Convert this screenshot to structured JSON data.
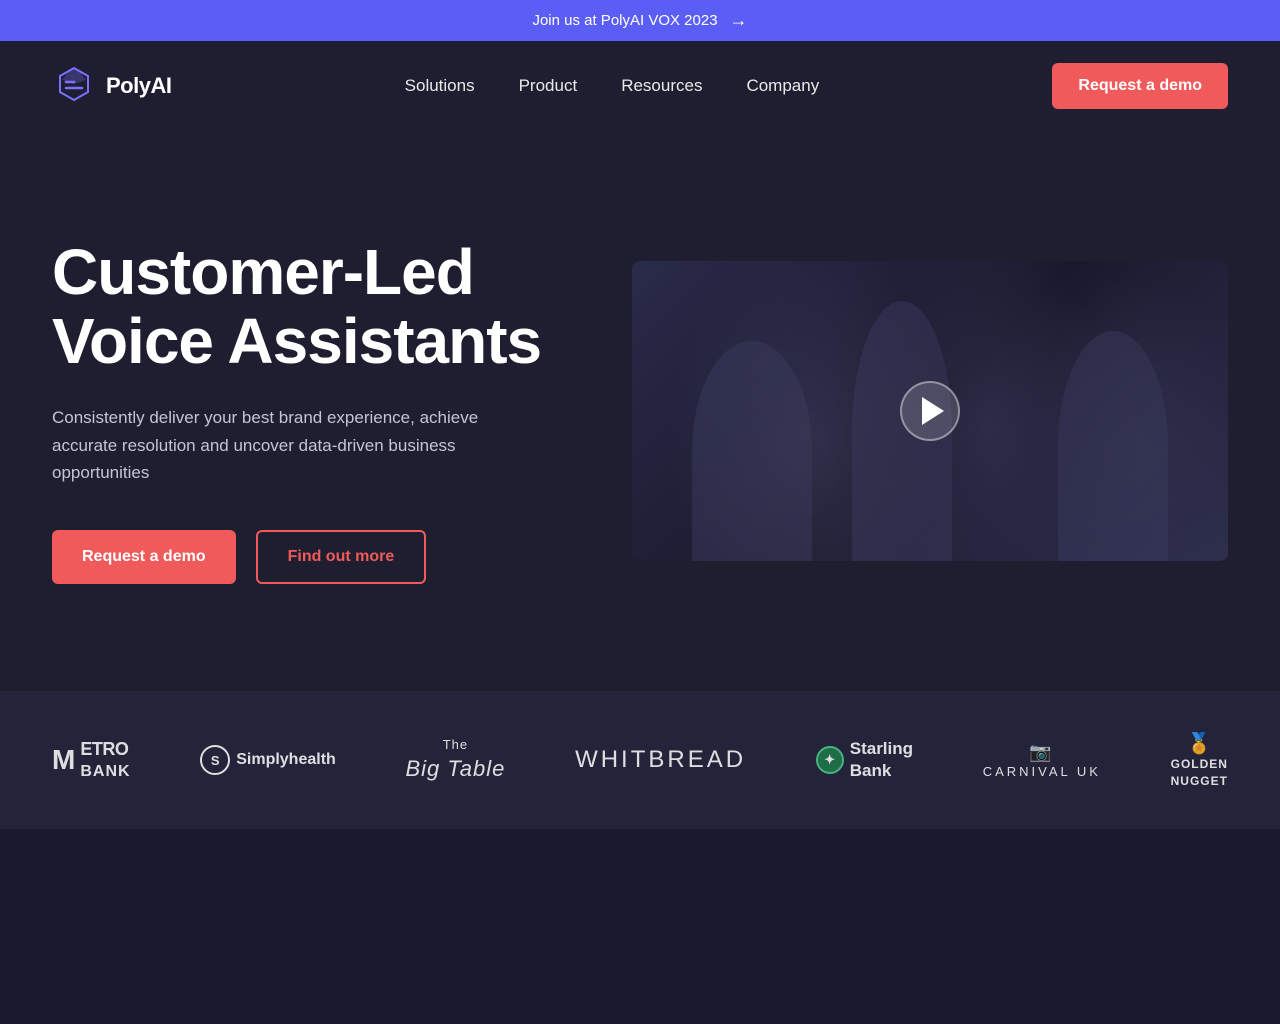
{
  "banner": {
    "text": "Join us at PolyAI VOX 2023",
    "arrow": "→"
  },
  "nav": {
    "logo_text": "PolyAI",
    "links": [
      {
        "label": "Solutions",
        "id": "solutions"
      },
      {
        "label": "Product",
        "id": "product"
      },
      {
        "label": "Resources",
        "id": "resources"
      },
      {
        "label": "Company",
        "id": "company"
      }
    ],
    "cta_label": "Request a demo"
  },
  "hero": {
    "title_line1": "Customer-Led",
    "title_line2": "Voice Assistants",
    "subtitle": "Consistently deliver your best brand experience, achieve accurate resolution and uncover data-driven business opportunities",
    "btn_primary": "Request a demo",
    "btn_outline": "Find out more"
  },
  "clients": [
    {
      "id": "metro-bank",
      "label": "METRO\nBANK",
      "type": "metro"
    },
    {
      "id": "simplyhealth",
      "label": "Simplyhealth",
      "type": "simply"
    },
    {
      "id": "big-table",
      "label": "The\nBig Table",
      "type": "bigtable"
    },
    {
      "id": "whitbread",
      "label": "WHITBREAD",
      "type": "whitbread"
    },
    {
      "id": "starling-bank",
      "label": "Starling\nBank",
      "type": "starling"
    },
    {
      "id": "carnival-uk",
      "label": "CARNIVAL UK",
      "type": "carnival"
    },
    {
      "id": "golden-nugget",
      "label": "GOLDEN\nNUGGET",
      "type": "golden"
    }
  ]
}
